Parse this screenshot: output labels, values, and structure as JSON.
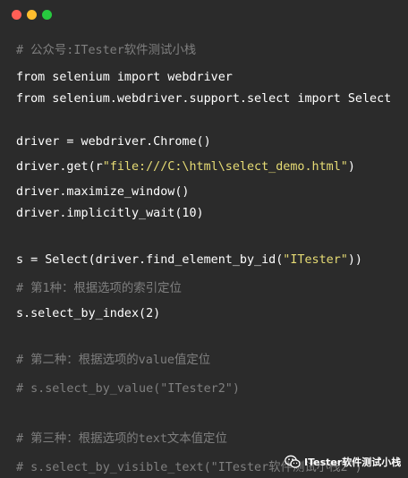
{
  "window": {
    "controls": [
      "close",
      "minimize",
      "maximize"
    ],
    "colors": {
      "background": "#2b2b2b",
      "close": "#ff5f56",
      "minimize": "#ffbd2e",
      "maximize": "#27c93f"
    }
  },
  "code": {
    "line_1": "# 公众号:ITester软件测试小栈",
    "line_2": "from selenium import webdriver",
    "line_3": "from selenium.webdriver.support.select import Select",
    "line_4": "driver = webdriver.Chrome()",
    "line_5_pre": "driver.get(r",
    "line_5_str": "\"file:///C:\\html\\select_demo.html\"",
    "line_5_post": ")",
    "line_6": "driver.maximize_window()",
    "line_7": "driver.implicitly_wait(10)",
    "line_8_pre": "s = Select(driver.find_element_by_id(",
    "line_8_str": "\"ITester\"",
    "line_8_post": "))",
    "line_9": "# 第1种：根据选项的索引定位",
    "line_10": "s.select_by_index(2)",
    "line_11": "# 第二种：根据选项的value值定位",
    "line_12": "# s.select_by_value(\"ITester2\")",
    "line_13": "# 第三种：根据选项的text文本值定位",
    "line_14": "# s.select_by_visible_text(\"ITester软件测试小栈2\")"
  },
  "colors": {
    "text": "#ffffff",
    "comment": "#7f7f7f",
    "string": "#e6db74"
  },
  "watermark": {
    "icon": "wechat-icon",
    "text": "ITester软件测试小栈"
  }
}
